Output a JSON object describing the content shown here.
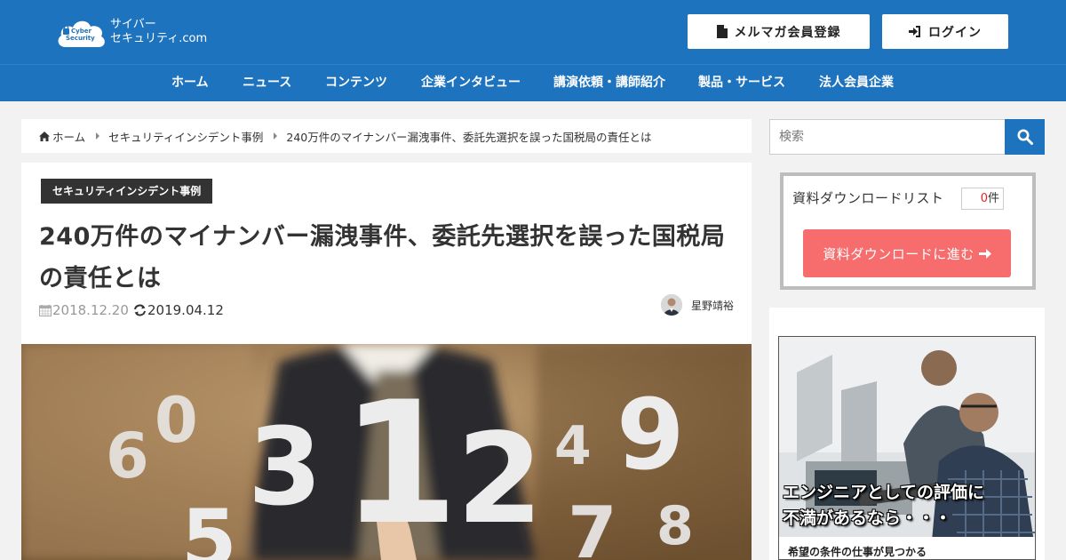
{
  "header": {
    "logo_line1": "サイバー",
    "logo_line2": "セキュリティ.com",
    "logo_badge_line1": "Cyber",
    "logo_badge_line2": "Security",
    "mailmag_label": "メルマガ会員登録",
    "login_label": "ログイン"
  },
  "nav": {
    "items": [
      "ホーム",
      "ニュース",
      "コンテンツ",
      "企業インタビュー",
      "講演依頼・講師紹介",
      "製品・サービス",
      "法人会員企業"
    ]
  },
  "breadcrumb": {
    "home": "ホーム",
    "category": "セキュリティインシデント事例",
    "current": "240万件のマイナンバー漏洩事件、委託先選択を誤った国税局の責任とは"
  },
  "article": {
    "category": "セキュリティインシデント事例",
    "title": "240万件のマイナンバー漏洩事件、委託先選択を誤った国税局の責任とは",
    "published": "2018.12.20",
    "updated": "2019.04.12",
    "author": "星野靖裕",
    "hero_digits": [
      "6",
      "0",
      "5",
      "3",
      "1",
      "2",
      "4",
      "9",
      "7",
      "8"
    ]
  },
  "sidebar": {
    "search_placeholder": "検索",
    "download_list_label": "資料ダウンロードリスト",
    "download_count": "0",
    "download_count_unit": "件",
    "download_button": "資料ダウンロードに進む",
    "ad_line1": "エンジニアとしての評価に",
    "ad_line2": "不満があるなら・・・",
    "ad_sub": "希望の条件の仕事が見つかる"
  },
  "colors": {
    "brand_blue": "#1e73be",
    "download_button": "#f76d6d",
    "category_label": "#333333"
  }
}
